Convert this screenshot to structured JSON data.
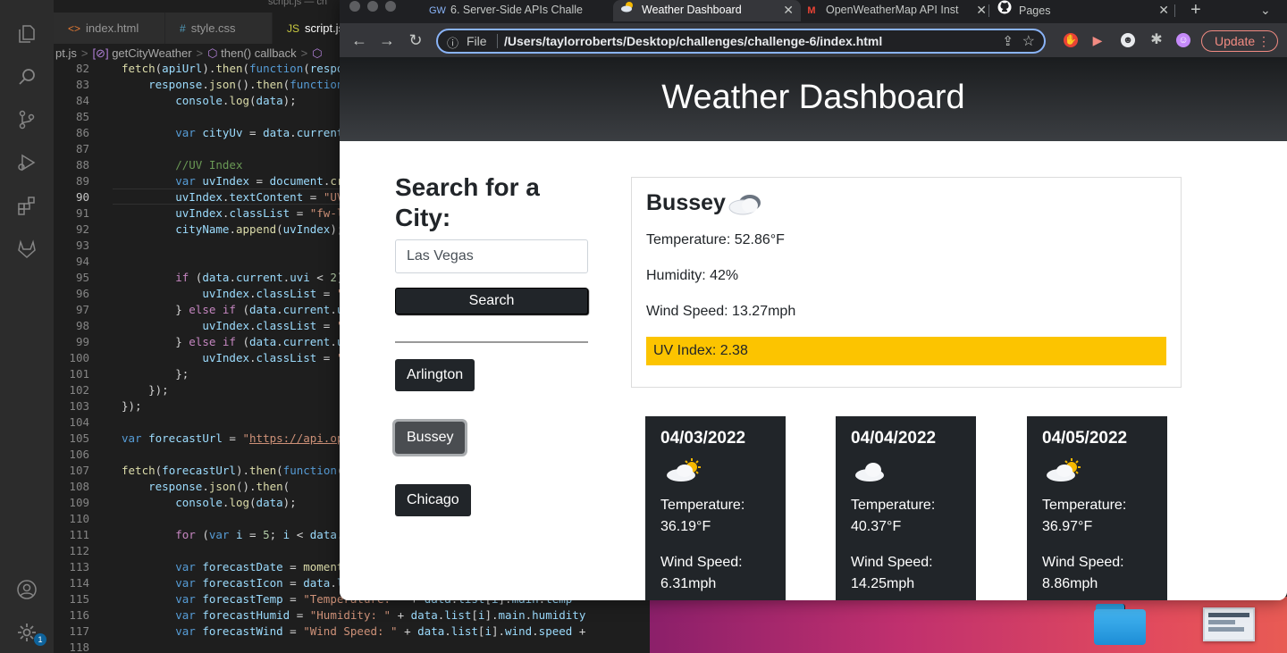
{
  "vscode": {
    "window_title": "script.js — ch",
    "tabs": [
      {
        "icon": "<>",
        "label": "index.html"
      },
      {
        "icon": "#",
        "label": "style.css"
      },
      {
        "icon": "JS",
        "label": "script.js"
      }
    ],
    "breadcrumb": [
      "pt.js",
      "getCityWeather",
      "then() callback"
    ],
    "settings_badge": "1",
    "code_lines": [
      {
        "n": "82",
        "html": "<span class=\"fn\">fetch</span>(<span class=\"vr\">apiUrl</span>).<span class=\"fn\">then</span>(<span class=\"kw\">function</span>(<span class=\"vr\">respon</span>"
      },
      {
        "n": "83",
        "html": "    <span class=\"vr\">response</span>.<span class=\"fn\">json</span>().<span class=\"fn\">then</span>(<span class=\"kw\">function</span>("
      },
      {
        "n": "84",
        "html": "        <span class=\"vr\">console</span>.<span class=\"fn\">log</span>(<span class=\"vr\">data</span>);"
      },
      {
        "n": "85",
        "html": ""
      },
      {
        "n": "86",
        "html": "        <span class=\"kw\">var</span> <span class=\"vr\">cityUv</span> = <span class=\"vr\">data</span>.<span class=\"vr\">current</span>."
      },
      {
        "n": "87",
        "html": ""
      },
      {
        "n": "88",
        "html": "        <span class=\"cm\">//UV Index</span>"
      },
      {
        "n": "89",
        "html": "        <span class=\"kw\">var</span> <span class=\"vr\">uvIndex</span> = <span class=\"vr\">document</span>.<span class=\"fn\">cre</span>"
      },
      {
        "n": "90",
        "html": "        <span class=\"vr\">uvIndex</span>.<span class=\"vr\">textContent</span> = <span class=\"st\">\"UV </span>"
      },
      {
        "n": "91",
        "html": "        <span class=\"vr\">uvIndex</span>.<span class=\"vr\">classList</span> = <span class=\"st\">\"fw-li</span>"
      },
      {
        "n": "92",
        "html": "        <span class=\"vr\">cityName</span>.<span class=\"fn\">append</span>(<span class=\"vr\">uvIndex</span>);"
      },
      {
        "n": "93",
        "html": ""
      },
      {
        "n": "94",
        "html": ""
      },
      {
        "n": "95",
        "html": "        <span class=\"kw2\">if</span> (<span class=\"vr\">data</span>.<span class=\"vr\">current</span>.<span class=\"vr\">uvi</span> &lt; <span class=\"nm\">2</span>)"
      },
      {
        "n": "96",
        "html": "            <span class=\"vr\">uvIndex</span>.<span class=\"vr\">classList</span> = <span class=\"st\">\"f</span>"
      },
      {
        "n": "97",
        "html": "        } <span class=\"kw2\">else if</span> (<span class=\"vr\">data</span>.<span class=\"vr\">current</span>.<span class=\"vr\">uv</span>"
      },
      {
        "n": "98",
        "html": "            <span class=\"vr\">uvIndex</span>.<span class=\"vr\">classList</span> = <span class=\"st\">\"f</span>"
      },
      {
        "n": "99",
        "html": "        } <span class=\"kw2\">else if</span> (<span class=\"vr\">data</span>.<span class=\"vr\">current</span>.<span class=\"vr\">uv</span>"
      },
      {
        "n": "100",
        "html": "            <span class=\"vr\">uvIndex</span>.<span class=\"vr\">classList</span> = <span class=\"st\">\"f</span>"
      },
      {
        "n": "101",
        "html": "        };"
      },
      {
        "n": "102",
        "html": "    });"
      },
      {
        "n": "103",
        "html": "});"
      },
      {
        "n": "104",
        "html": ""
      },
      {
        "n": "105",
        "html": "<span class=\"kw\">var</span> <span class=\"vr\">forecastUrl</span> = <span class=\"st\">\"<u>https://api.ope</u></span>"
      },
      {
        "n": "106",
        "html": ""
      },
      {
        "n": "107",
        "html": "<span class=\"fn\">fetch</span>(<span class=\"vr\">forecastUrl</span>).<span class=\"fn\">then</span>(<span class=\"kw\">function</span>(<span class=\"vr\">r</span>"
      },
      {
        "n": "108",
        "html": "    <span class=\"vr\">response</span>.<span class=\"fn\">json</span>().<span class=\"fn\">then</span>("
      },
      {
        "n": "109",
        "html": "        <span class=\"vr\">console</span>.<span class=\"fn\">log</span>(<span class=\"vr\">data</span>);"
      },
      {
        "n": "110",
        "html": ""
      },
      {
        "n": "111",
        "html": "        <span class=\"kw2\">for</span> (<span class=\"kw\">var</span> <span class=\"vr\">i</span> = <span class=\"nm\">5</span>; <span class=\"vr\">i</span> &lt; <span class=\"vr\">data</span>.<span class=\"vr\">l</span>"
      },
      {
        "n": "112",
        "html": ""
      },
      {
        "n": "113",
        "html": "        <span class=\"kw\">var</span> <span class=\"vr\">forecastDate</span> = <span class=\"fn\">moment</span>("
      },
      {
        "n": "114",
        "html": "        <span class=\"kw\">var</span> <span class=\"vr\">forecastIcon</span> = <span class=\"vr\">data</span>.<span class=\"vr\">li</span>"
      },
      {
        "n": "115",
        "html": "        <span class=\"kw\">var</span> <span class=\"vr\">forecastTemp</span> = <span class=\"st\">\"Temperature: \"</span> + <span class=\"vr\">data</span>.<span class=\"vr\">list</span>[<span class=\"vr\">i</span>].<span class=\"vr\">main</span>.<span class=\"vr\">temp</span>"
      },
      {
        "n": "116",
        "html": "        <span class=\"kw\">var</span> <span class=\"vr\">forecastHumid</span> = <span class=\"st\">\"Humidity: \"</span> + <span class=\"vr\">data</span>.<span class=\"vr\">list</span>[<span class=\"vr\">i</span>].<span class=\"vr\">main</span>.<span class=\"vr\">humidity</span>"
      },
      {
        "n": "117",
        "html": "        <span class=\"kw\">var</span> <span class=\"vr\">forecastWind</span> = <span class=\"st\">\"Wind Speed: \"</span> + <span class=\"vr\">data</span>.<span class=\"vr\">list</span>[<span class=\"vr\">i</span>].<span class=\"vr\">wind</span>.<span class=\"vr\">speed</span> +"
      },
      {
        "n": "118",
        "html": ""
      }
    ]
  },
  "chrome": {
    "tabs": [
      {
        "favicon": "GW",
        "label": "6. Server-Side APIs Challe"
      },
      {
        "favicon": "weather",
        "label": "Weather Dashboard"
      },
      {
        "favicon": "M",
        "label": "OpenWeatherMap API Inst"
      },
      {
        "favicon": "github",
        "label": "Pages"
      }
    ],
    "new_tab": "+",
    "omnibox": {
      "scheme_label": "File",
      "url": "/Users/taylorroberts/Desktop/challenges/challenge-6/index.html"
    },
    "update_label": "Update"
  },
  "page": {
    "title": "Weather Dashboard",
    "search_heading": "Search for a City:",
    "search_value": "Las Vegas",
    "search_button": "Search",
    "history": [
      "Arlington",
      "Bussey",
      "Chicago"
    ],
    "current": {
      "city": "Bussey",
      "temperature": "Temperature: 52.86°F",
      "humidity": "Humidity: 42%",
      "wind": "Wind Speed: 13.27mph",
      "uv": "UV Index: 2.38",
      "uv_color": "#fcc400"
    },
    "forecast": [
      {
        "date": "04/03/2022",
        "icon": "partly-cloudy-sun",
        "temp": "Temperature: 36.19°F",
        "wind": "Wind Speed: 6.31mph"
      },
      {
        "date": "04/04/2022",
        "icon": "cloud",
        "temp": "Temperature: 40.37°F",
        "wind": "Wind Speed: 14.25mph"
      },
      {
        "date": "04/05/2022",
        "icon": "partly-cloudy-sun",
        "temp": "Temperature: 36.97°F",
        "wind": "Wind Speed: 8.86mph"
      }
    ]
  }
}
